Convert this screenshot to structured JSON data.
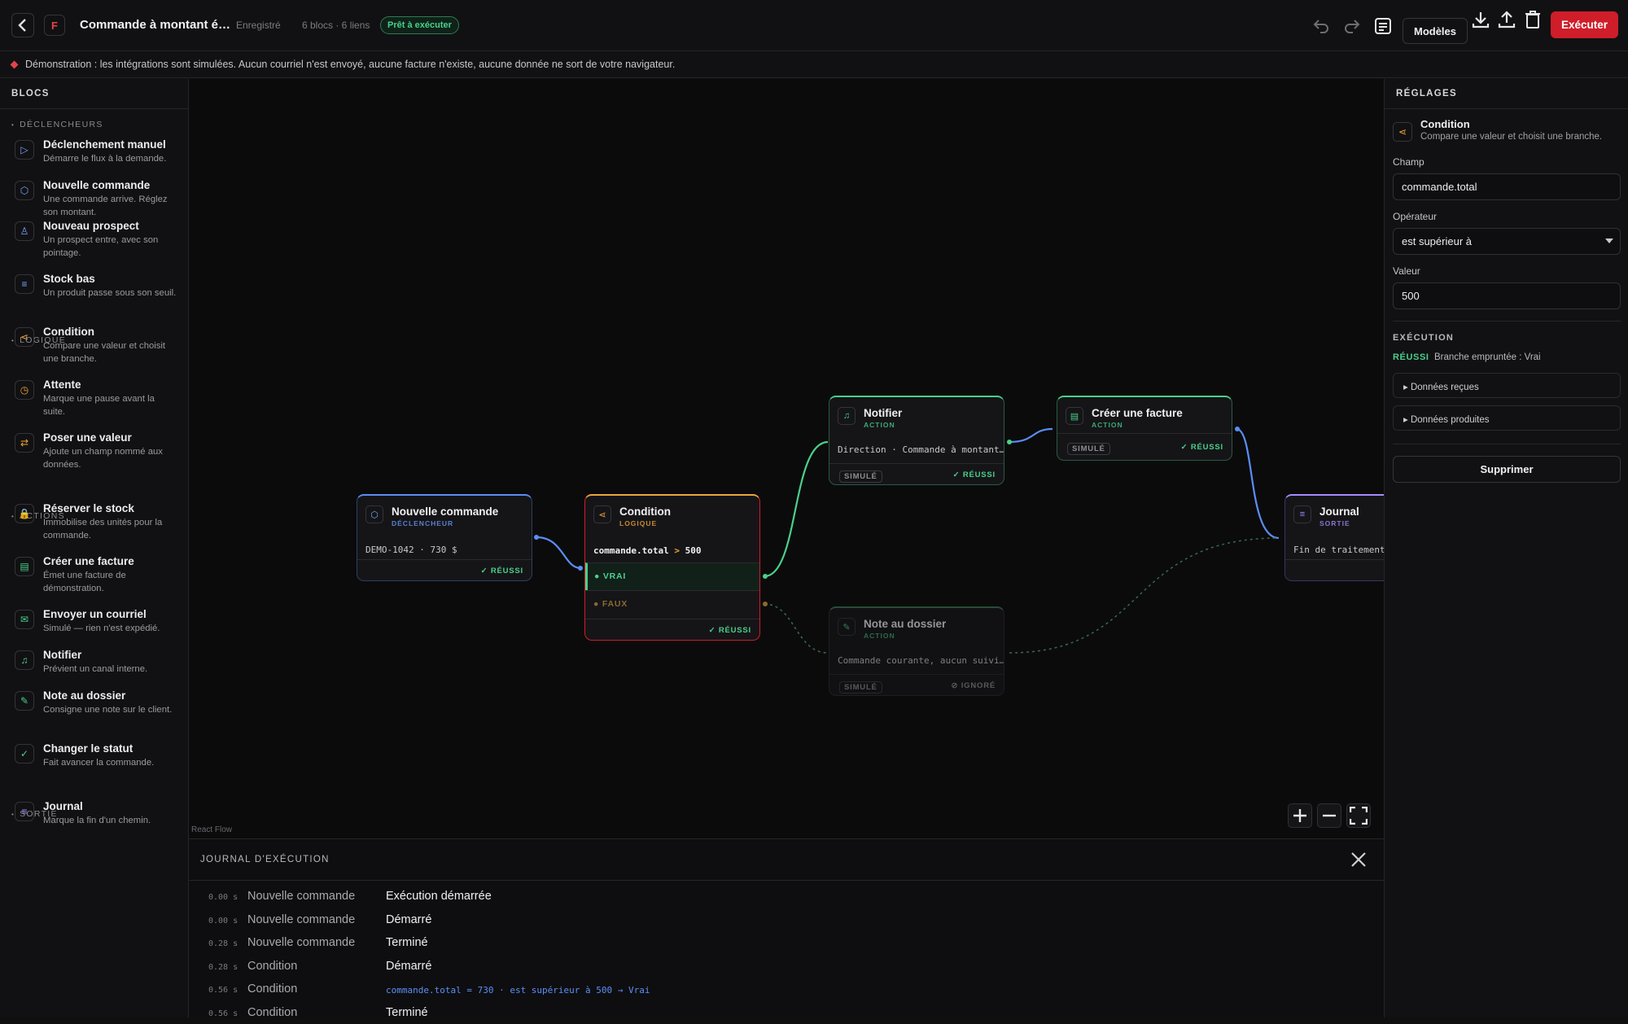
{
  "app": {
    "logo_letter": "F",
    "title": "Commande à montant é…",
    "saved": "Enregistré",
    "counts": "6 blocs · 6 liens",
    "status": "Prêt à exécuter",
    "templates_label": "Modèles",
    "execute_label": "Exécuter"
  },
  "banner": {
    "text": "Démonstration : les intégrations sont simulées. Aucun courriel n'est envoyé, aucune facture n'existe, aucune donnée ne sort de votre navigateur."
  },
  "sidebar": {
    "title": "BLOCS",
    "groups": {
      "triggers": "DÉCLENCHEURS",
      "logic": "LOGIQUE",
      "actions": "ACTIONS",
      "output": "SORTIE"
    },
    "items": [
      {
        "title": "Déclenchement manuel",
        "desc": "Démarre le flux à la demande.",
        "icon": "play-icon",
        "color": "#7aa2ff"
      },
      {
        "title": "Nouvelle commande",
        "desc": "Une commande arrive. Réglez son montant.",
        "icon": "box-icon",
        "color": "#7aa2ff"
      },
      {
        "title": "Nouveau prospect",
        "desc": "Un prospect entre, avec son pointage.",
        "icon": "user-icon",
        "color": "#7aa2ff"
      },
      {
        "title": "Stock bas",
        "desc": "Un produit passe sous son seuil.",
        "icon": "list-icon",
        "color": "#7aa2ff"
      },
      {
        "title": "Condition",
        "desc": "Compare une valeur et choisit une branche.",
        "icon": "branch-icon",
        "color": "#f0a53a"
      },
      {
        "title": "Attente",
        "desc": "Marque une pause avant la suite.",
        "icon": "clock-icon",
        "color": "#f0a53a"
      },
      {
        "title": "Poser une valeur",
        "desc": "Ajoute un champ nommé aux données.",
        "icon": "swap-icon",
        "color": "#f0a53a"
      },
      {
        "title": "Réserver le stock",
        "desc": "Immobilise des unités pour la commande.",
        "icon": "lock-icon",
        "color": "#4ad08a"
      },
      {
        "title": "Créer une facture",
        "desc": "Émet une facture de démonstration.",
        "icon": "document-icon",
        "color": "#4ad08a"
      },
      {
        "title": "Envoyer un courriel",
        "desc": "Simulé — rien n'est expédié.",
        "icon": "mail-icon",
        "color": "#4ad08a"
      },
      {
        "title": "Notifier",
        "desc": "Prévient un canal interne.",
        "icon": "bell-icon",
        "color": "#4ad08a"
      },
      {
        "title": "Note au dossier",
        "desc": "Consigne une note sur le client.",
        "icon": "pencil-icon",
        "color": "#4ad08a"
      },
      {
        "title": "Changer le statut",
        "desc": "Fait avancer la commande.",
        "icon": "check-circle-icon",
        "color": "#4ad08a"
      },
      {
        "title": "Journal",
        "desc": "Marque la fin d'un chemin.",
        "icon": "list-icon",
        "color": "#a98bff"
      }
    ]
  },
  "nodes": {
    "order": {
      "title": "Nouvelle commande",
      "sub": "DÉCLENCHEUR",
      "body": "DEMO-1042 · 730 $",
      "status": "✓ RÉUSSI"
    },
    "condition": {
      "title": "Condition",
      "sub": "LOGIQUE",
      "field": "commande.total",
      "op": ">",
      "value": "500",
      "true_label": "VRAI",
      "false_label": "FAUX",
      "status": "✓ RÉUSSI"
    },
    "notify": {
      "title": "Notifier",
      "sub": "ACTION",
      "body": "Direction · Commande à montant…",
      "left": "SIMULÉ",
      "status": "✓ RÉUSSI"
    },
    "invoice": {
      "title": "Créer une facture",
      "sub": "ACTION",
      "left": "SIMULÉ",
      "status": "✓ RÉUSSI"
    },
    "note": {
      "title": "Note au dossier",
      "sub": "ACTION",
      "body": "Commande courante, aucun suivi…",
      "left": "SIMULÉ",
      "status": "⊘ IGNORÉ"
    },
    "journal": {
      "title": "Journal",
      "sub": "SORTIE",
      "body": "Fin de traitement"
    }
  },
  "canvas": {
    "attribution": "React Flow"
  },
  "settings": {
    "title": "RÉGLAGES",
    "block_title": "Condition",
    "block_desc": "Compare une valeur et choisit une branche.",
    "field_label": "Champ",
    "field_value": "commande.total",
    "op_label": "Opérateur",
    "op_value": "est supérieur à",
    "value_label": "Valeur",
    "value_value": "500",
    "exec_title": "EXÉCUTION",
    "exec_status": "RÉUSSI",
    "exec_detail": "Branche empruntée : Vrai",
    "received": "▸ Données reçues",
    "produced": "▸ Données produites",
    "delete_label": "Supprimer"
  },
  "log": {
    "title": "JOURNAL D'EXÉCUTION",
    "rows": [
      {
        "t": "0.00 s",
        "src": "Nouvelle commande",
        "msg": "Exécution démarrée"
      },
      {
        "t": "0.00 s",
        "src": "Nouvelle commande",
        "msg": "Démarré"
      },
      {
        "t": "0.28 s",
        "src": "Nouvelle commande",
        "msg": "Terminé"
      },
      {
        "t": "0.28 s",
        "src": "Condition",
        "msg": "Démarré"
      },
      {
        "t": "0.56 s",
        "src": "Condition",
        "code": "commande.total = 730 · est supérieur à 500 → Vrai"
      },
      {
        "t": "0.56 s",
        "src": "Condition",
        "msg": "Terminé"
      }
    ]
  },
  "colors": {
    "accent_red": "#cf1d2a",
    "success": "#4ad08a",
    "trigger_blue": "#7aa2ff",
    "logic_orange": "#f0a53a",
    "action_green": "#4ad08a",
    "output_purple": "#a98bff"
  }
}
